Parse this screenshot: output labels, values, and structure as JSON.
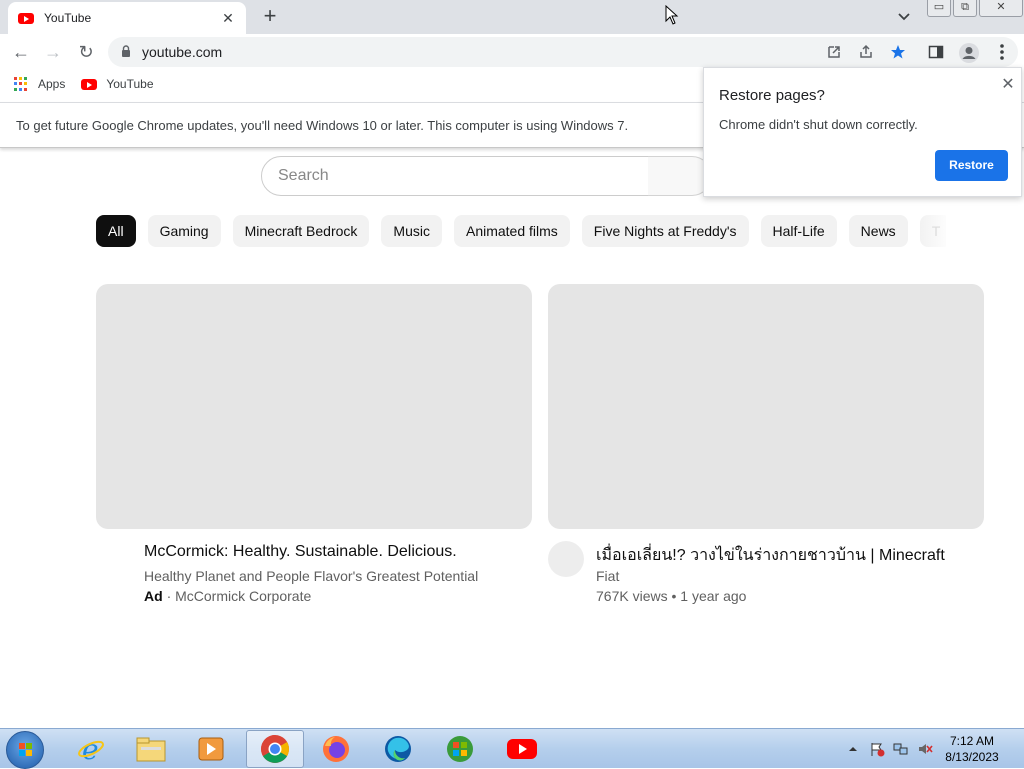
{
  "browser": {
    "tab_title": "YouTube",
    "tab_close": "✕",
    "new_tab": "+",
    "url": "youtube.com",
    "nav": {
      "back": "←",
      "forward": "→",
      "reload": "↻"
    },
    "bookmarks": [
      {
        "label": "Apps",
        "icon": "apps-grid-icon"
      },
      {
        "label": "YouTube",
        "icon": "youtube-icon"
      }
    ],
    "window_buttons": {
      "minimize": "▭",
      "restore": "⧉",
      "close": "✕"
    },
    "infobar_text": "To get future Google Chrome updates, you'll need Windows 10 or later. This computer is using Windows 7."
  },
  "restore_popup": {
    "title": "Restore pages?",
    "message": "Chrome didn't shut down correctly.",
    "button": "Restore",
    "close": "✕"
  },
  "youtube": {
    "search_placeholder": "Search",
    "chips": [
      "All",
      "Gaming",
      "Minecraft Bedrock",
      "Music",
      "Animated films",
      "Five Nights at Freddy's",
      "Half-Life",
      "News",
      "T"
    ],
    "videos": [
      {
        "title": "McCormick: Healthy. Sustainable. Delicious.",
        "line1": "Healthy Planet and People Flavor's Greatest Potential",
        "ad_badge": "Ad",
        "channel": "· McCormick Corporate"
      },
      {
        "title": "เมื่อเอเลี่ยน!? วางไข่ในร่างกายชาวบ้าน | Minecraft",
        "channel": "Fiat",
        "stats": "767K views • 1 year ago"
      }
    ]
  },
  "taskbar": {
    "items": [
      "internet-explorer-icon",
      "file-explorer-icon",
      "media-player-icon",
      "chrome-icon",
      "firefox-icon",
      "edge-icon",
      "windows-update-icon",
      "youtube-app-icon"
    ],
    "clock_time": "7:12 AM",
    "clock_date": "8/13/2023"
  },
  "colors": {
    "accent": "#1a73e8",
    "youtube_red": "#ff0000"
  }
}
